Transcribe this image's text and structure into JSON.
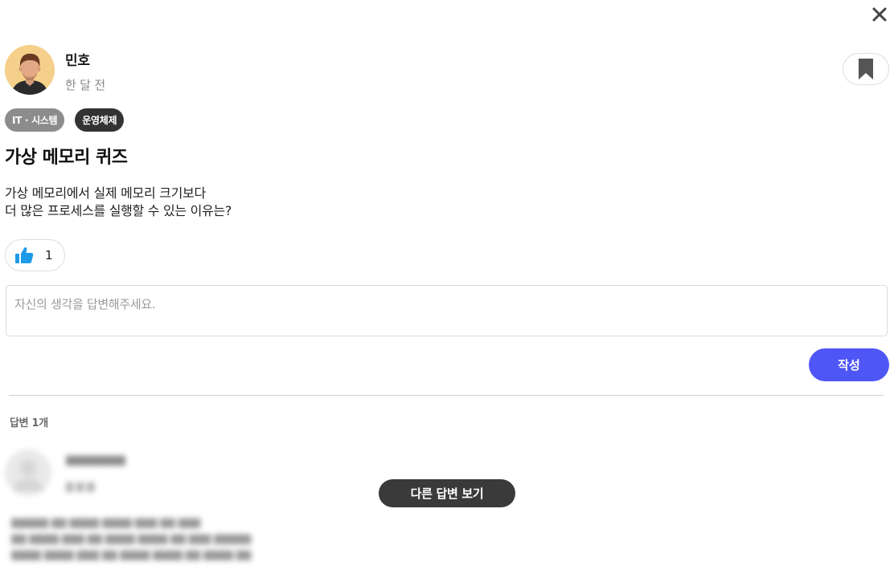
{
  "author": {
    "name": "민호",
    "time": "한 달 전"
  },
  "tags": [
    "IT · 시스템",
    "운영체제"
  ],
  "post": {
    "title": "가상 메모리 퀴즈",
    "body_lines": [
      "가상 메모리에서 실제 메모리 크기보다",
      "더 많은 프로세스를 실행할 수 있는 이유는?"
    ]
  },
  "likes": {
    "count": "1"
  },
  "answer_form": {
    "placeholder": "자신의 생각을 답변해주세요.",
    "value": "",
    "submit_label": "작성"
  },
  "answers": {
    "count_label": "답변 1개",
    "more_label": "다른 답변 보기"
  },
  "icons": {
    "close": "close-icon",
    "bookmark": "bookmark-icon",
    "like": "thumbs-up-icon"
  },
  "colors": {
    "primary": "#4e56f6",
    "like_icon": "#1e9be8",
    "tag_gray": "#8c8c8c",
    "tag_dark": "#333333",
    "more_button": "#3a3a3a"
  }
}
